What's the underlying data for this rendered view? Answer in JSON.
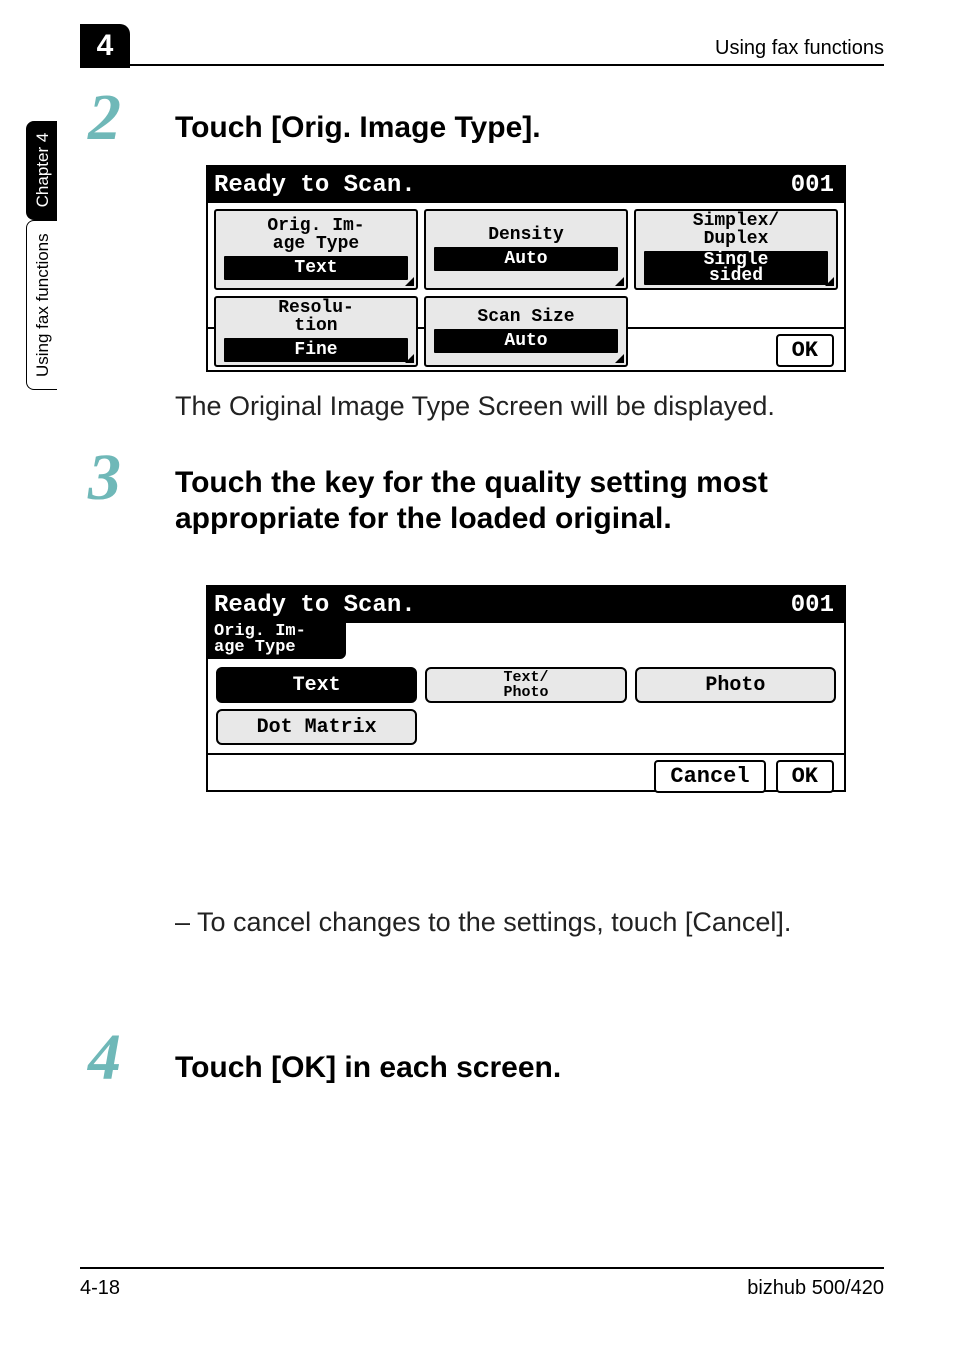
{
  "chapter_badge": "4",
  "header": {
    "title": "Using fax functions"
  },
  "side_tabs": {
    "section": "Using fax functions",
    "chapter": "Chapter 4"
  },
  "footer": {
    "left": "4-18",
    "right": "bizhub 500/420"
  },
  "steps": {
    "s2": {
      "num": "2",
      "heading": "Touch [Orig. Image Type]."
    },
    "s3": {
      "num": "3",
      "heading": "Touch the key for the quality setting most appropriate for the loaded original."
    },
    "s4": {
      "num": "4",
      "heading": "Touch [OK] in each screen."
    }
  },
  "body": {
    "after_step2_pre": "The ",
    "after_step2_osd": "Original Image Type",
    "after_step2_post": " Screen will be displayed.",
    "cancel_note": "– To cancel changes to the settings, touch [Cancel]."
  },
  "lcd1": {
    "title": "Ready to Scan.",
    "counter": "001",
    "cells": {
      "orig_label1": "Orig. Im-",
      "orig_label2": "age Type",
      "orig_value": "Text",
      "density_label": "Density",
      "density_value": "Auto",
      "simplex_label1": "Simplex/",
      "simplex_label2": "Duplex",
      "simplex_value1": "Single",
      "simplex_value2": "sided",
      "resolu_label1": "Resolu-",
      "resolu_label2": "tion",
      "resolu_value": "Fine",
      "scan_label": "Scan Size",
      "scan_value": "Auto"
    },
    "ok": "OK"
  },
  "lcd2": {
    "title": "Ready to Scan.",
    "counter": "001",
    "subheader1": "Orig. Im-",
    "subheader2": "age Type",
    "options": {
      "text": "Text",
      "textphoto1": "Text/",
      "textphoto2": "Photo",
      "photo": "Photo",
      "dotmatrix": "Dot Matrix"
    },
    "cancel": "Cancel",
    "ok": "OK"
  }
}
